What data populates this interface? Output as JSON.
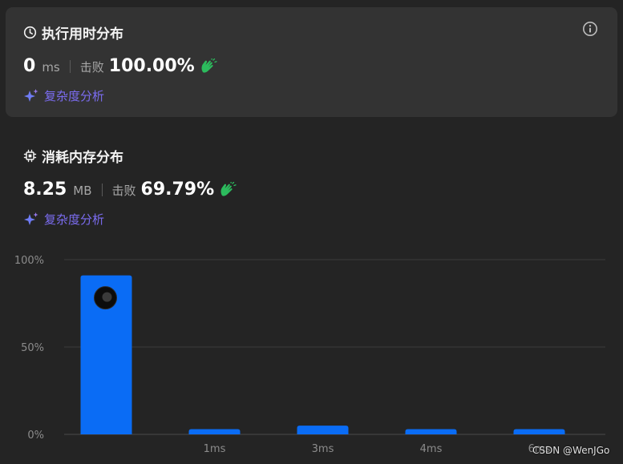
{
  "runtime": {
    "title": "执行用时分布",
    "value": "0",
    "unit": "ms",
    "beat_label": "击败",
    "beat_percent": "100.00%",
    "analysis_label": "复杂度分析"
  },
  "memory": {
    "title": "消耗内存分布",
    "value": "8.25",
    "unit": "MB",
    "beat_label": "击败",
    "beat_percent": "69.79%",
    "analysis_label": "复杂度分析"
  },
  "colors": {
    "bar": "#0a6cf5",
    "accent": "#7b6cf0",
    "hands": "#2cbb5d",
    "background": "#242424",
    "card": "#333333"
  },
  "icons": {
    "runtime": "clock-icon",
    "memory": "chip-icon",
    "info": "info-icon",
    "analysis": "sparkle-icon",
    "beat": "clapping-hands-icon"
  },
  "chart_data": {
    "type": "bar",
    "y_tick_labels": [
      "100%",
      "50%",
      "0%"
    ],
    "ylim": [
      0,
      100
    ],
    "categories": [
      "",
      "1ms",
      "3ms",
      "4ms",
      "6ms"
    ],
    "values": [
      91,
      3,
      5,
      3,
      3
    ],
    "highlight_index": 0,
    "grid": true
  },
  "watermark": "CSDN @WenJGo"
}
